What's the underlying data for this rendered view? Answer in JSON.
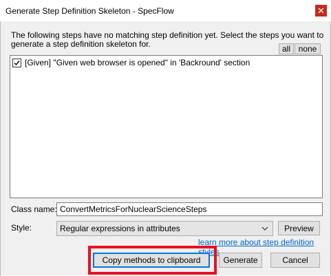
{
  "window": {
    "title": "Generate Step Definition Skeleton - SpecFlow",
    "close_glyph": "✕"
  },
  "description": "The following steps have no matching step definition yet. Select the steps you want to generate a step definition skeleton for.",
  "selection": {
    "all_label": "all",
    "none_label": "none"
  },
  "steps": [
    {
      "checked": true,
      "text": "[Given] \"Given web browser is opened\" in 'Backround' section"
    }
  ],
  "class_name": {
    "label": "Class name:",
    "value": "ConvertMetricsForNuclearScienceSteps"
  },
  "style": {
    "label": "Style:",
    "selected": "Regular expressions in attributes",
    "preview_label": "Preview",
    "learn_more_link": "learn more about step definition styles"
  },
  "actions": {
    "copy_label": "Copy methods to clipboard",
    "generate_label": "Generate",
    "cancel_label": "Cancel"
  },
  "colors": {
    "highlight": "#e81123",
    "link": "#0066cc",
    "focus_border": "#0078d7"
  },
  "icons": [
    "close-icon",
    "checkmark-icon",
    "chevron-down-icon"
  ]
}
